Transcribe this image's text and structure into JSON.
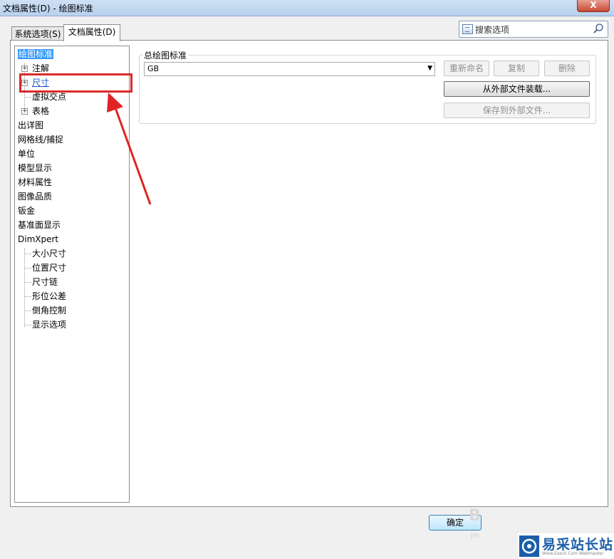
{
  "window": {
    "title": "文档属性(D) - 绘图标准",
    "close_label": "X"
  },
  "tabs": [
    {
      "label": "系统选项(S)",
      "active": false
    },
    {
      "label": "文档属性(D)",
      "active": true
    }
  ],
  "search": {
    "placeholder": "搜索选项",
    "icon": "magnifier-icon"
  },
  "tree": {
    "items": [
      {
        "label": "绘图标准",
        "selected": true
      },
      {
        "label": "注解",
        "expandable": true
      },
      {
        "label": "尺寸",
        "expandable": true,
        "link": true
      },
      {
        "label": "虚拟交点"
      },
      {
        "label": "表格",
        "expandable": true
      },
      {
        "label": "出详图"
      },
      {
        "label": "网格线/捕捉"
      },
      {
        "label": "单位"
      },
      {
        "label": "模型显示"
      },
      {
        "label": "材料属性"
      },
      {
        "label": "图像品质"
      },
      {
        "label": "钣金"
      },
      {
        "label": "基准面显示"
      },
      {
        "label": "DimXpert"
      },
      {
        "label": "大小尺寸"
      },
      {
        "label": "位置尺寸"
      },
      {
        "label": "尺寸链"
      },
      {
        "label": "形位公差"
      },
      {
        "label": "倒角控制"
      },
      {
        "label": "显示选项"
      }
    ]
  },
  "standard": {
    "group_label": "总绘图标准",
    "selected_value": "GB",
    "buttons": {
      "rename": "重新命名",
      "copy": "复制",
      "delete": "删除",
      "load_external": "从外部文件装载...",
      "save_external": "保存到外部文件..."
    }
  },
  "footer": {
    "ok_label": "确定"
  },
  "watermark": {
    "letter": "B",
    "small": "jin"
  },
  "logo": {
    "text": "易采站长站",
    "sub": "Www.Easck.Com Webmaster"
  },
  "annotation": {
    "highlight_color": "#d92b2b"
  }
}
